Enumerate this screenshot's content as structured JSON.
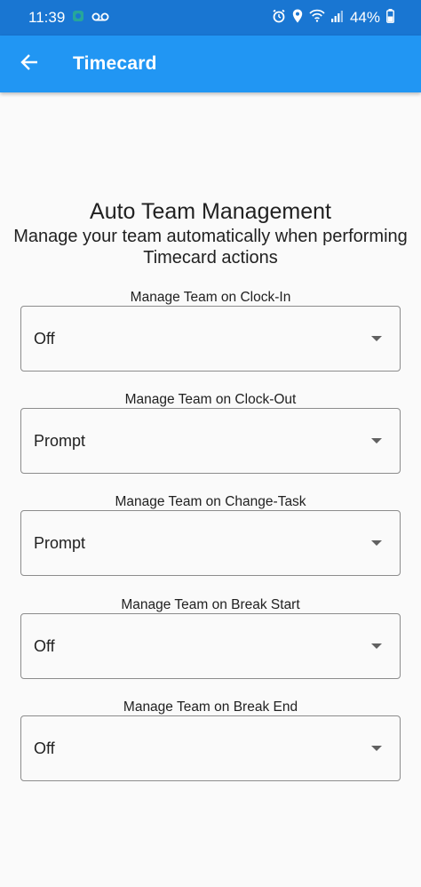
{
  "status_bar": {
    "time": "11:39",
    "battery": "44%",
    "icons": [
      "app-notification-icon",
      "voicemail-icon",
      "alarm-icon",
      "location-icon",
      "wifi-icon",
      "signal-icon",
      "battery-icon"
    ]
  },
  "app_bar": {
    "title": "Timecard",
    "back_icon": "arrow-left-icon"
  },
  "header": {
    "title": "Auto Team Management",
    "subtitle_line1": "Manage your team automatically when performing",
    "subtitle_line2": "Timecard actions"
  },
  "fields": [
    {
      "label": "Manage Team on Clock-In",
      "value": "Off"
    },
    {
      "label": "Manage Team on Clock-Out",
      "value": "Prompt"
    },
    {
      "label": "Manage Team on Change-Task",
      "value": "Prompt"
    },
    {
      "label": "Manage Team on Break Start",
      "value": "Off"
    },
    {
      "label": "Manage Team on Break End",
      "value": "Off"
    }
  ],
  "colors": {
    "app_bar": "#2196f3",
    "status_bar": "#1976d2",
    "background": "#fafafa"
  }
}
